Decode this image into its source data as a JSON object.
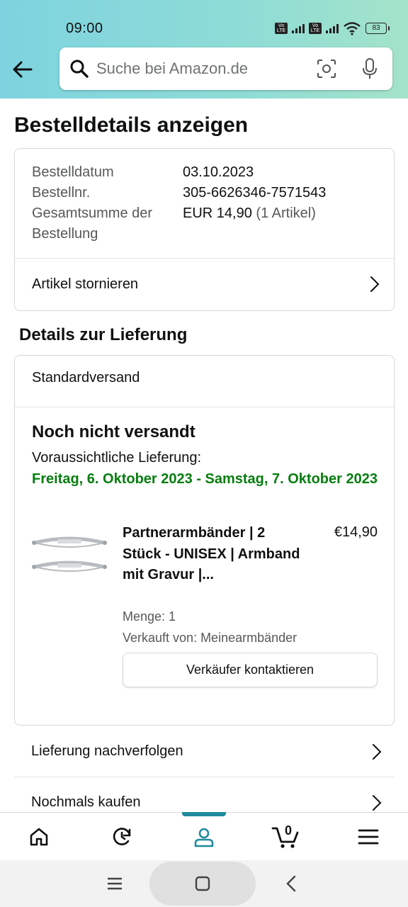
{
  "status_bar": {
    "time": "09:00",
    "battery": "83",
    "volte_label": "Vo LTE"
  },
  "search": {
    "placeholder": "Suche bei Amazon.de"
  },
  "page": {
    "title": "Bestelldetails anzeigen"
  },
  "order_summary": {
    "date_label": "Bestelldatum",
    "date_value": "03.10.2023",
    "number_label": "Bestellnr.",
    "number_value": "305-6626346-7571543",
    "total_label_line1": "Gesamtsumme der",
    "total_label_line2": "Bestellung",
    "total_value": "EUR 14,90",
    "total_items": "(1 Artikel)",
    "cancel_link": "Artikel stornieren"
  },
  "delivery": {
    "section_title": "Details zur Lieferung",
    "shipping_method": "Standardversand",
    "status": "Noch nicht versandt",
    "expected_label": "Voraussichtliche Lieferung:",
    "expected_dates": "Freitag, 6. Oktober 2023 - Samstag, 7. Oktober 2023"
  },
  "product": {
    "title": "Partnerarmbänder | 2 Stück - UNISEX | Armband mit Gravur |...",
    "price": "€14,90",
    "quantity": "Menge: 1",
    "seller": "Verkauft von: Meinearmbänder",
    "contact_button": "Verkäufer kontaktieren"
  },
  "actions": [
    {
      "label": "Lieferung nachverfolgen"
    },
    {
      "label": "Nochmals kaufen"
    }
  ],
  "bottom_nav": {
    "items": [
      "home-icon",
      "history-icon",
      "account-icon",
      "cart-icon",
      "menu-icon"
    ],
    "active": "account-icon",
    "cart_count": "0",
    "accent_color": "#1f8a9d"
  },
  "colors": {
    "delivery_green": "#067d0f",
    "header_gradient_start": "#7dd3df",
    "header_gradient_end": "#a4e3c9"
  }
}
